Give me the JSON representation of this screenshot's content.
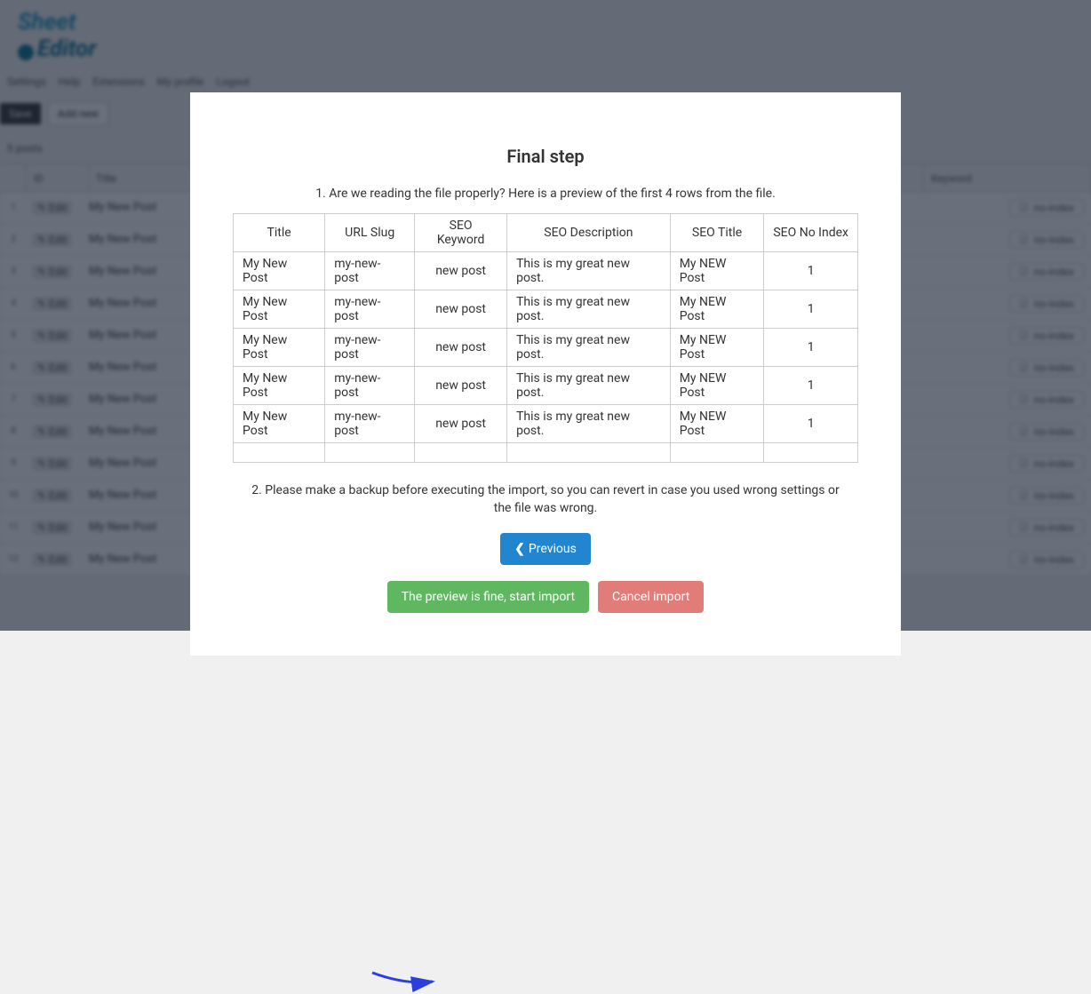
{
  "logo": {
    "line1": "Sheet",
    "line2": "Editor"
  },
  "topbar": {
    "items": [
      "Settings",
      "Help",
      "Extensions",
      "My profile",
      "Logout"
    ]
  },
  "toolbar": {
    "dark": "Save",
    "light": "Add new"
  },
  "count_label": "5 posts",
  "grid": {
    "headers": [
      "",
      "ID",
      "Title",
      "",
      "",
      "",
      "",
      "Keyword"
    ],
    "row_lock_text": "✎ Edit",
    "row_title": "My New Post",
    "pill_label": "no-index",
    "rows_count": 12
  },
  "modal": {
    "title": "Final step",
    "step1": "1. Are we reading the file properly? Here is a preview of the first 4 rows from the file.",
    "step2": "2. Please make a backup before executing the import, so you can revert in case you used wrong settings or the file was wrong.",
    "previous": "Previous",
    "start_import": "The preview is fine, start import",
    "cancel_import": "Cancel import",
    "table": {
      "headers": [
        "Title",
        "URL Slug",
        "SEO Keyword",
        "SEO Description",
        "SEO Title",
        "SEO No Index"
      ],
      "rows": [
        {
          "title": "My New Post",
          "slug": "my-new-post",
          "keyword": "new post",
          "desc": "This is my great new post.",
          "seotitle": "My NEW Post",
          "noindex": "1"
        },
        {
          "title": "My New Post",
          "slug": "my-new-post",
          "keyword": "new post",
          "desc": "This is my great new post.",
          "seotitle": "My NEW Post",
          "noindex": "1"
        },
        {
          "title": "My New Post",
          "slug": "my-new-post",
          "keyword": "new post",
          "desc": "This is my great new post.",
          "seotitle": "My NEW Post",
          "noindex": "1"
        },
        {
          "title": "My New Post",
          "slug": "my-new-post",
          "keyword": "new post",
          "desc": "This is my great new post.",
          "seotitle": "My NEW Post",
          "noindex": "1"
        },
        {
          "title": "My New Post",
          "slug": "my-new-post",
          "keyword": "new post",
          "desc": "This is my great new post.",
          "seotitle": "My NEW Post",
          "noindex": "1"
        }
      ]
    }
  }
}
